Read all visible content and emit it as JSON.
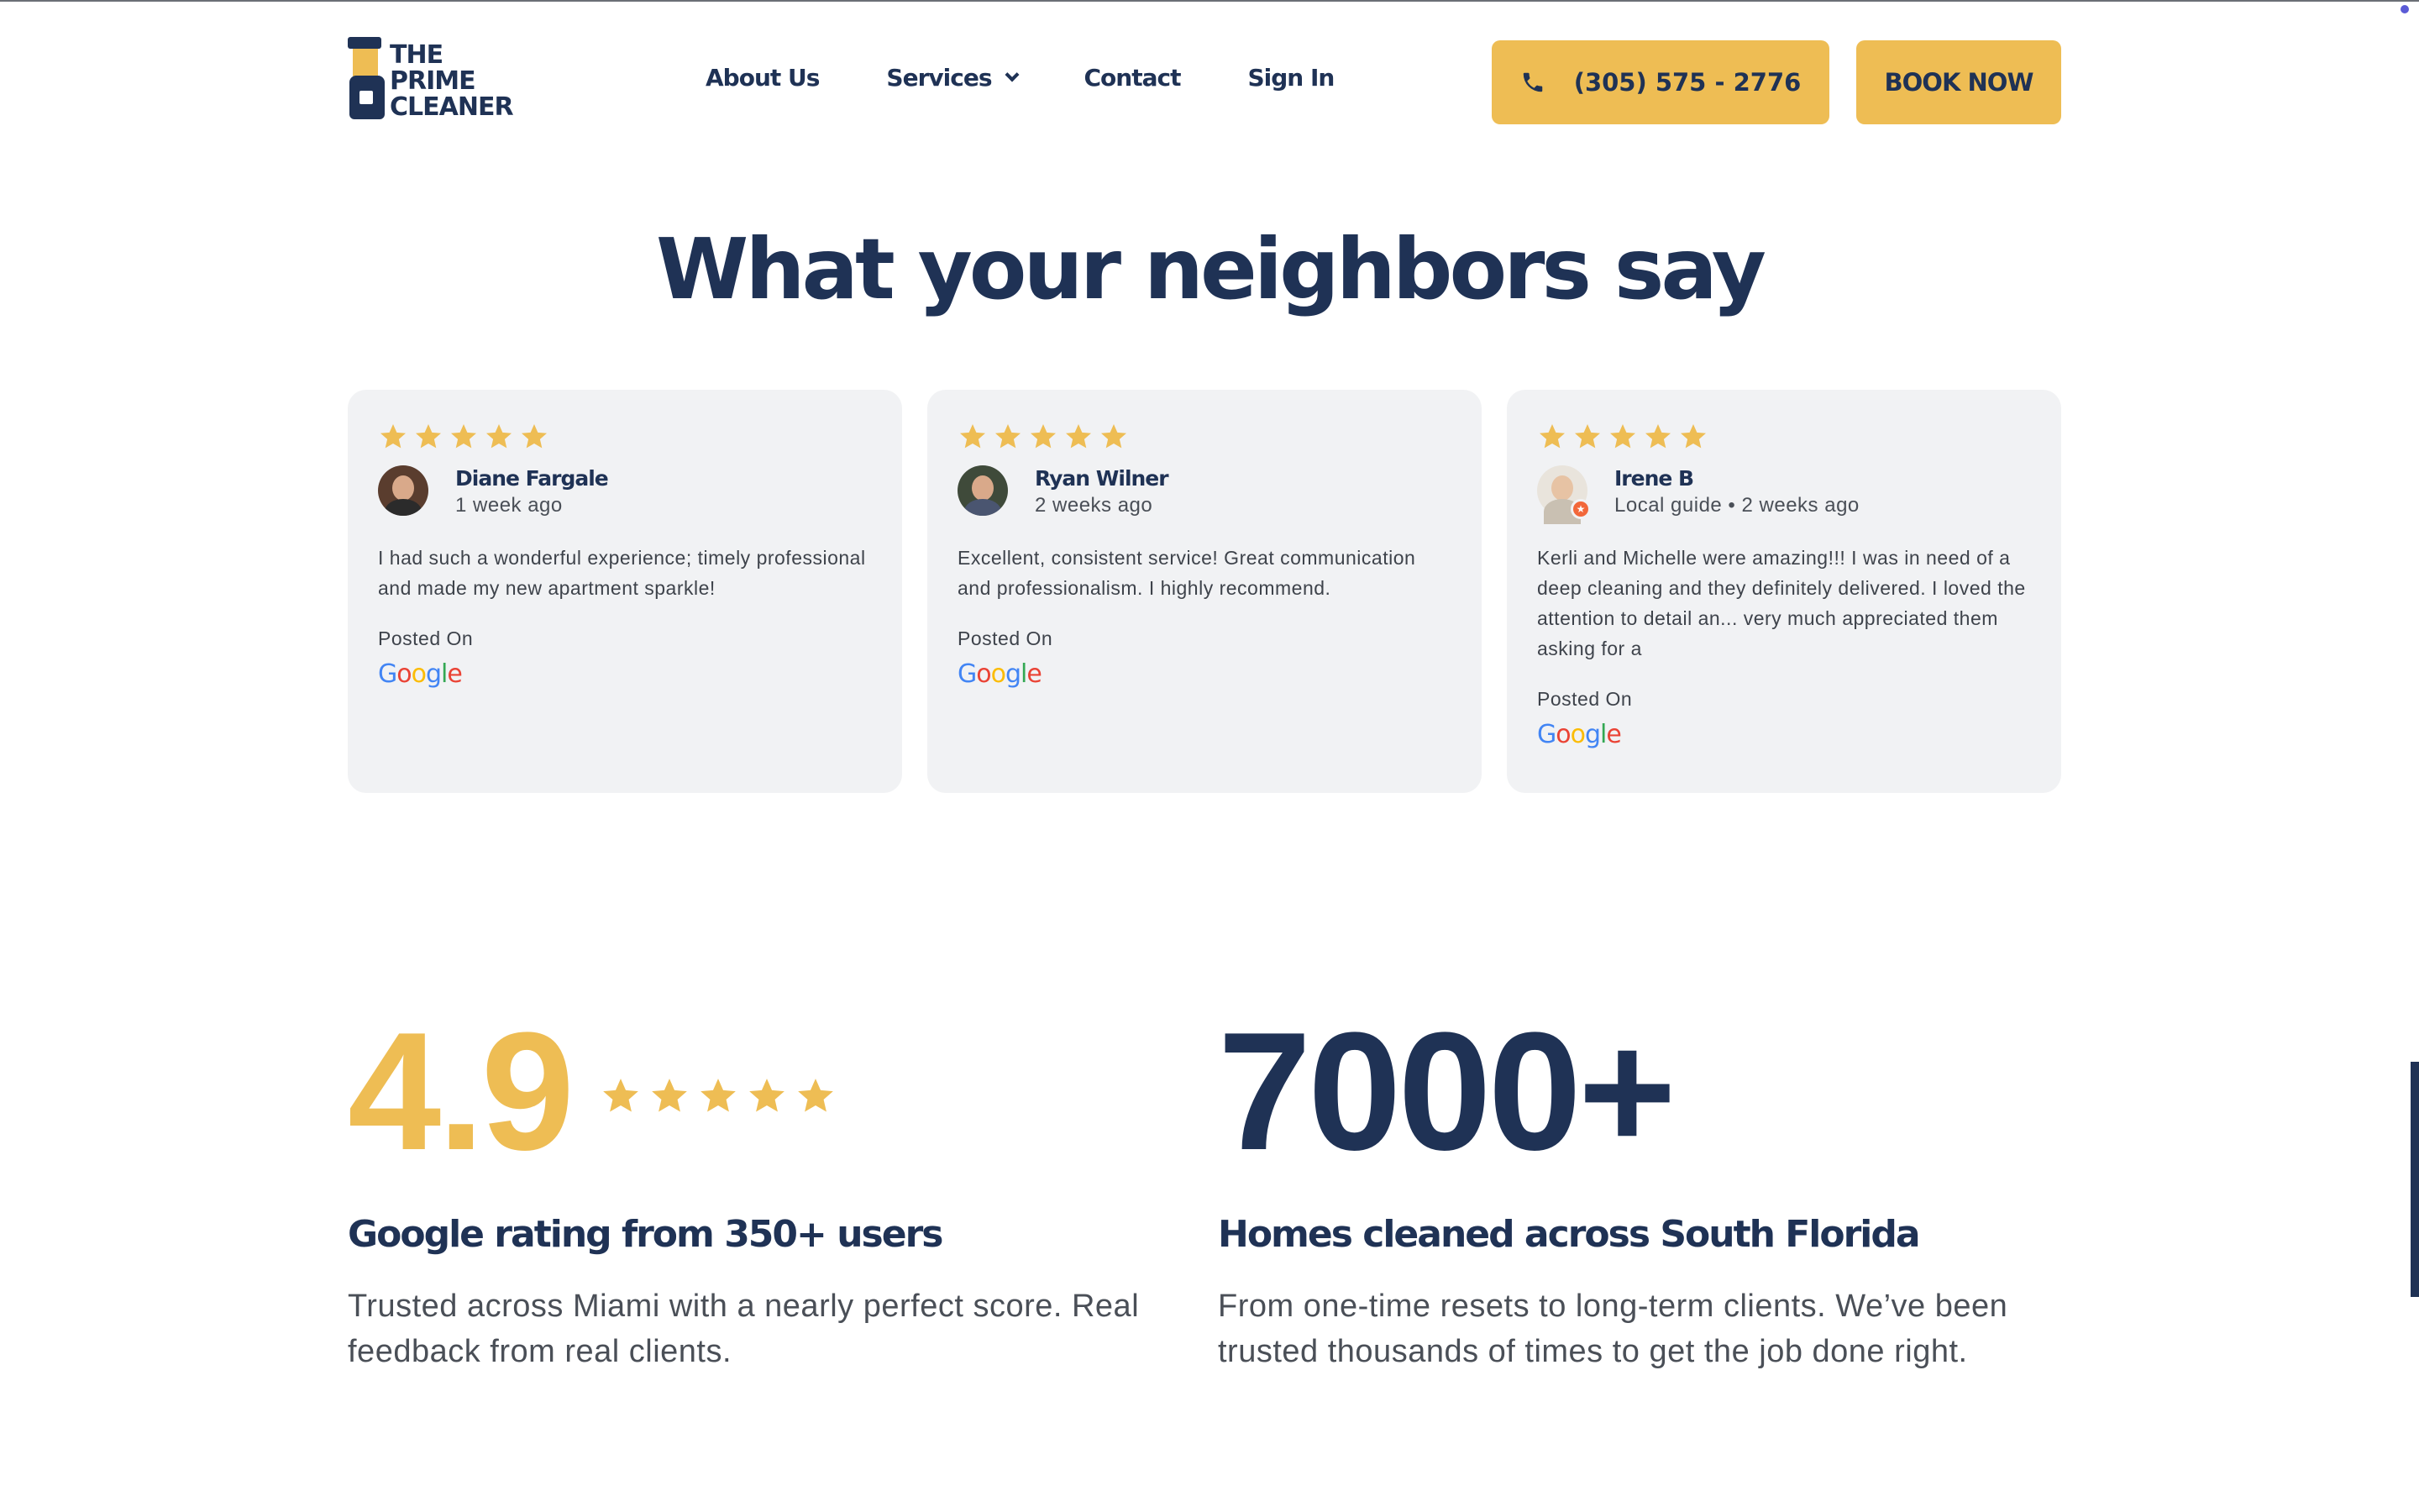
{
  "brand": {
    "logo_lines": [
      "THE",
      "PRIME",
      "CLEANER"
    ],
    "gold": "#eebd54",
    "navy": "#1f3255"
  },
  "nav": {
    "items": [
      {
        "label": "About Us"
      },
      {
        "label": "Services",
        "has_dropdown": true
      },
      {
        "label": "Contact"
      },
      {
        "label": "Sign In"
      }
    ]
  },
  "header": {
    "phone_label": "(305) 575 - 2776",
    "phone_icon": "phone-icon",
    "book_label": "BOOK NOW"
  },
  "reviews": {
    "title": "What your neighbors say",
    "items": [
      {
        "stars": 5,
        "name": "Diane Fargale",
        "meta": "1 week ago",
        "text": "I had such a wonderful experience; timely professional and made my new apartment sparkle!",
        "posted_on": "Posted On",
        "source": "Google"
      },
      {
        "stars": 5,
        "name": "Ryan Wilner",
        "meta": "2 weeks ago",
        "text": "Excellent, consistent service! Great communication and professionalism. I highly recommend.",
        "posted_on": "Posted On",
        "source": "Google"
      },
      {
        "stars": 5,
        "name": "Irene B",
        "meta": "Local guide • 2 weeks ago",
        "text": "Kerli and Michelle were amazing!!! I was in need of a deep cleaning and they definitely delivered. I loved the attention to detail an... very much appreciated them asking for a",
        "posted_on": "Posted On",
        "source": "Google"
      }
    ]
  },
  "stats": {
    "rating": {
      "value": "4.9",
      "stars": 5,
      "title": "Google rating from 350+ users",
      "description": "Trusted across Miami with a nearly perfect score. Real feedback from real clients."
    },
    "homes": {
      "value": "7000+",
      "title": "Homes cleaned across South Florida",
      "description": "From one-time resets to long-term clients. We’ve been trusted thousands of times to get the job done right."
    }
  }
}
